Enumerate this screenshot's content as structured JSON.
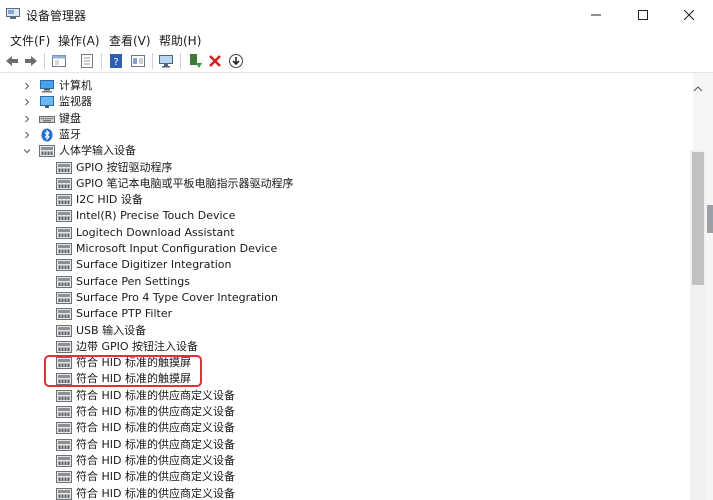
{
  "window": {
    "title": "设备管理器"
  },
  "menu": [
    "文件(F)",
    "操作(A)",
    "查看(V)",
    "帮助(H)"
  ],
  "toolbar": [
    {
      "name": "back-arrow-icon"
    },
    {
      "name": "forward-arrow-icon"
    },
    {
      "name": "properties-icon"
    },
    {
      "name": "update-driver-icon"
    },
    {
      "name": "help-icon"
    },
    {
      "name": "show-hidden-icon"
    },
    {
      "name": "monitor-scan-icon"
    },
    {
      "name": "add-device-icon"
    },
    {
      "name": "uninstall-x-icon"
    },
    {
      "name": "download-driver-icon"
    }
  ],
  "tree": {
    "categories": [
      {
        "label": "计算机",
        "icon": "computer-icon",
        "expanded": false
      },
      {
        "label": "监视器",
        "icon": "monitor-icon",
        "expanded": false
      },
      {
        "label": "键盘",
        "icon": "keyboard-icon",
        "expanded": false
      },
      {
        "label": "蓝牙",
        "icon": "bluetooth-icon",
        "expanded": false
      },
      {
        "label": "人体学输入设备",
        "icon": "hid-icon",
        "expanded": true
      }
    ],
    "hid_children": [
      "GPIO 按钮驱动程序",
      "GPIO 笔记本电脑或平板电脑指示器驱动程序",
      "I2C HID 设备",
      "Intel(R) Precise Touch Device",
      "Logitech Download Assistant",
      "Microsoft Input Configuration Device",
      "Surface Digitizer Integration",
      "Surface Pen Settings",
      "Surface Pro 4 Type Cover Integration",
      "Surface PTP Filter",
      "USB 输入设备",
      "边带 GPIO 按钮注入设备",
      "符合 HID 标准的触摸屏",
      "符合 HID 标准的触摸屏",
      "符合 HID 标准的供应商定义设备",
      "符合 HID 标准的供应商定义设备",
      "符合 HID 标准的供应商定义设备",
      "符合 HID 标准的供应商定义设备",
      "符合 HID 标准的供应商定义设备",
      "符合 HID 标准的供应商定义设备",
      "符合 HID 标准的供应商定义设备"
    ],
    "highlighted_children": [
      12,
      13
    ]
  },
  "colors": {
    "highlight": "#e0303a",
    "bluetooth": "#1f6fd1",
    "accent": "#2b78c2"
  }
}
